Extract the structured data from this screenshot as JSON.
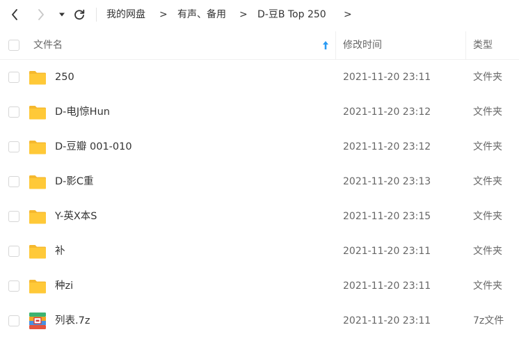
{
  "breadcrumb": {
    "items": [
      "我的网盘",
      "有声、备用",
      "D-豆B Top 250"
    ],
    "separator": ">"
  },
  "header": {
    "name": "文件名",
    "modified": "修改时间",
    "type": "类型"
  },
  "files": [
    {
      "name": "250",
      "modified": "2021-11-20 23:11",
      "type": "文件夹",
      "icon": "folder-icon"
    },
    {
      "name": "D-电J惊Hun",
      "modified": "2021-11-20 23:12",
      "type": "文件夹",
      "icon": "folder-icon"
    },
    {
      "name": "D-豆瓣 001-010",
      "modified": "2021-11-20 23:12",
      "type": "文件夹",
      "icon": "folder-icon"
    },
    {
      "name": "D-影C重",
      "modified": "2021-11-20 23:13",
      "type": "文件夹",
      "icon": "folder-icon"
    },
    {
      "name": "Y-英X本S",
      "modified": "2021-11-20 23:15",
      "type": "文件夹",
      "icon": "folder-icon"
    },
    {
      "name": "补",
      "modified": "2021-11-20 23:11",
      "type": "文件夹",
      "icon": "folder-icon"
    },
    {
      "name": "种zi",
      "modified": "2021-11-20 23:11",
      "type": "文件夹",
      "icon": "folder-icon"
    },
    {
      "name": "列表.7z",
      "modified": "2021-11-20 23:11",
      "type": "7z文件",
      "icon": "archive-7z-icon"
    }
  ],
  "colors": {
    "folder": "#ffc938",
    "accent": "#2a9bf4",
    "text": "#333333",
    "muted": "#666666"
  }
}
